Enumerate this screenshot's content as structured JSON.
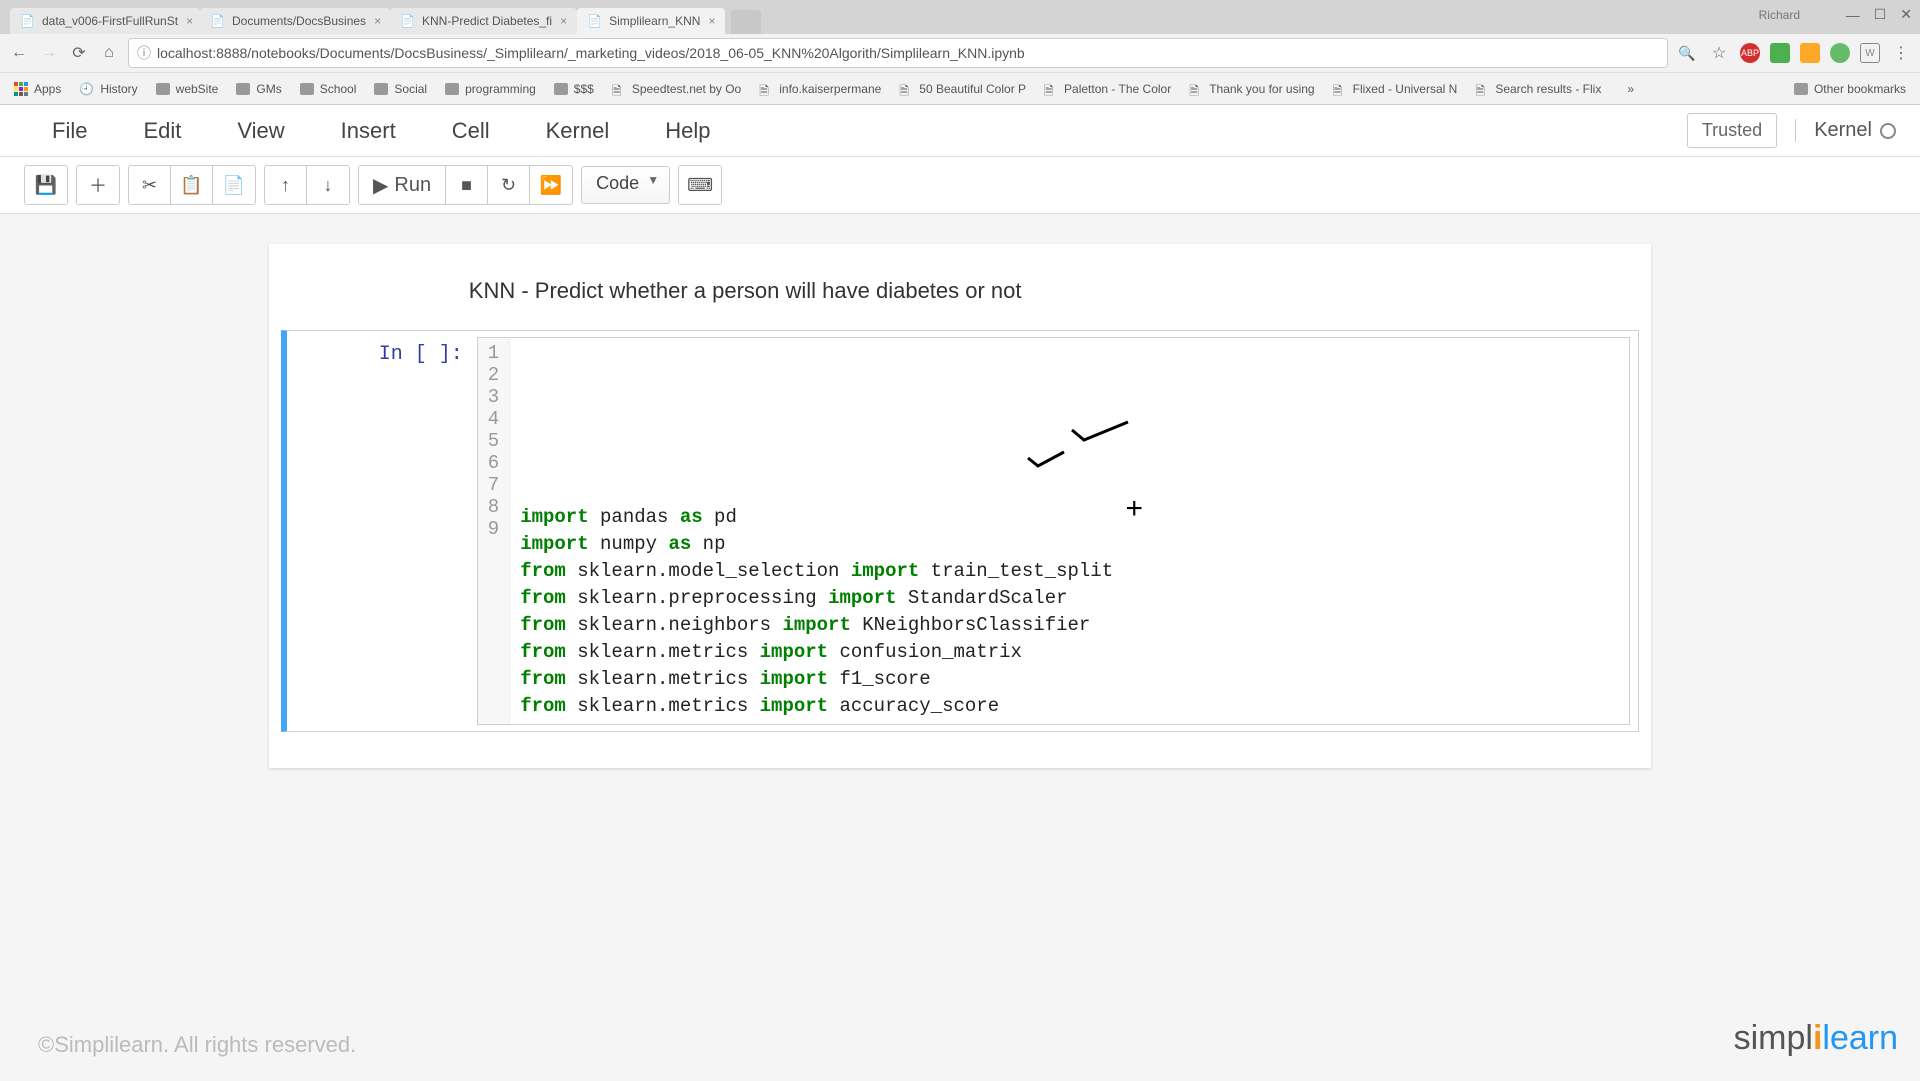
{
  "browser": {
    "tabs": [
      {
        "label": "data_v006-FirstFullRunSt"
      },
      {
        "label": "Documents/DocsBusines"
      },
      {
        "label": "KNN-Predict Diabetes_fi"
      },
      {
        "label": "Simplilearn_KNN"
      }
    ],
    "active_tab_index": 3,
    "url": "localhost:8888/notebooks/Documents/DocsBusiness/_Simplilearn/_marketing_videos/2018_06-05_KNN%20Algorith/Simplilearn_KNN.ipynb",
    "user": "Richard",
    "bookmarks": [
      {
        "label": "Apps",
        "type": "apps"
      },
      {
        "label": "History",
        "type": "icon"
      },
      {
        "label": "webSite",
        "type": "folder"
      },
      {
        "label": "GMs",
        "type": "folder"
      },
      {
        "label": "School",
        "type": "folder"
      },
      {
        "label": "Social",
        "type": "folder"
      },
      {
        "label": "programming",
        "type": "folder"
      },
      {
        "label": "$$$",
        "type": "folder"
      },
      {
        "label": "Speedtest.net by Oo",
        "type": "fav"
      },
      {
        "label": "info.kaiserpermane",
        "type": "fav"
      },
      {
        "label": "50 Beautiful Color P",
        "type": "fav"
      },
      {
        "label": "Paletton - The Color",
        "type": "fav"
      },
      {
        "label": "Thank you for using",
        "type": "fav"
      },
      {
        "label": "Flixed - Universal N",
        "type": "fav"
      },
      {
        "label": "Search results - Flix",
        "type": "fav"
      }
    ],
    "other_bookmarks": "Other bookmarks"
  },
  "jupyter": {
    "menu": [
      "File",
      "Edit",
      "View",
      "Insert",
      "Cell",
      "Kernel",
      "Help"
    ],
    "trusted": "Trusted",
    "kernel_label": "Kernel",
    "toolbar": {
      "run_label": "Run",
      "cell_type": "Code"
    }
  },
  "notebook": {
    "markdown_title": "KNN - Predict whether a person will have diabetes or not",
    "prompt": "In [ ]:",
    "code_lines": [
      {
        "n": 1,
        "tokens": [
          [
            "kw",
            "import"
          ],
          [
            "plain",
            " pandas "
          ],
          [
            "kw",
            "as"
          ],
          [
            "plain",
            " pd"
          ]
        ]
      },
      {
        "n": 2,
        "tokens": [
          [
            "kw",
            "import"
          ],
          [
            "plain",
            " numpy "
          ],
          [
            "kw",
            "as"
          ],
          [
            "plain",
            " np"
          ]
        ]
      },
      {
        "n": 3,
        "tokens": [
          [
            "plain",
            ""
          ]
        ]
      },
      {
        "n": 4,
        "tokens": [
          [
            "kw",
            "from"
          ],
          [
            "plain",
            " sklearn.model_selection "
          ],
          [
            "kw",
            "import"
          ],
          [
            "plain",
            " train_test_split"
          ]
        ]
      },
      {
        "n": 5,
        "tokens": [
          [
            "kw",
            "from"
          ],
          [
            "plain",
            " sklearn.preprocessing "
          ],
          [
            "kw",
            "import"
          ],
          [
            "plain",
            " StandardScaler"
          ]
        ]
      },
      {
        "n": 6,
        "tokens": [
          [
            "kw",
            "from"
          ],
          [
            "plain",
            " sklearn.neighbors "
          ],
          [
            "kw",
            "import"
          ],
          [
            "plain",
            " KNeighborsClassifier"
          ]
        ]
      },
      {
        "n": 7,
        "tokens": [
          [
            "kw",
            "from"
          ],
          [
            "plain",
            " sklearn.metrics "
          ],
          [
            "kw",
            "import"
          ],
          [
            "plain",
            " confusion_matrix"
          ]
        ]
      },
      {
        "n": 8,
        "tokens": [
          [
            "kw",
            "from"
          ],
          [
            "plain",
            " sklearn.metrics "
          ],
          [
            "kw",
            "import"
          ],
          [
            "plain",
            " f1_score"
          ]
        ]
      },
      {
        "n": 9,
        "tokens": [
          [
            "kw",
            "from"
          ],
          [
            "plain",
            " sklearn.metrics "
          ],
          [
            "kw",
            "import"
          ],
          [
            "plain",
            " accuracy_score"
          ]
        ]
      }
    ]
  },
  "footer": {
    "copyright": "©Simplilearn. All rights reserved.",
    "logo_parts": {
      "a": "simpl",
      "b": "i",
      "c": "learn"
    }
  }
}
